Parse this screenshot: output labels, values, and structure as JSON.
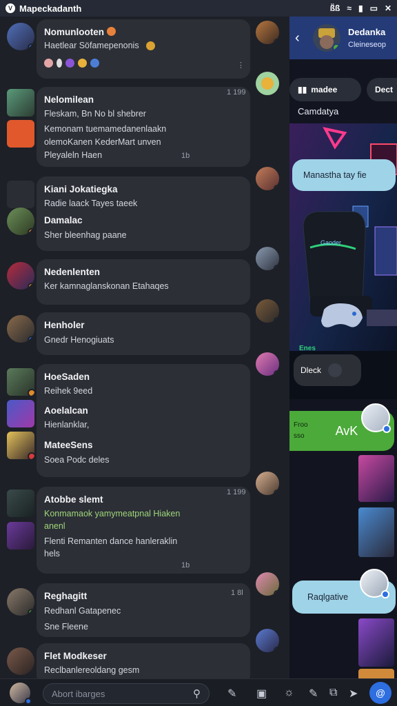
{
  "status": {
    "app_title": "Mapeckadanth",
    "right_text": "ß̈ß"
  },
  "chats": [
    {
      "title": "Nomunlooten",
      "line1": "Haetlear Söfamepenonis",
      "time": ""
    },
    {
      "title": "Nelomilean",
      "line1": "Fleskam, Bn No bl shebrer",
      "line2": "Kemonam tuemamedanenlaakn",
      "line3": "olemoKanen KederMart unven",
      "line4": "Pleyaleln Haen",
      "time": "1 199",
      "count": "1b"
    },
    {
      "title": "Kiani Jokatiegka",
      "line1": "Radie laack Tayes taeek",
      "sub_title": "Damalac",
      "sub_line": "Sher bleenhag paane"
    },
    {
      "title": "Nedenlenten",
      "line1": "Ker kamnaglanskonan Etahaqes"
    },
    {
      "title": "Henholer",
      "line1": "Gnedr Henogiuats"
    },
    {
      "title": "HoeSaden",
      "line1": "Reihek 9eed",
      "sub_title": "Aoelalcan",
      "sub_line": "Hienlanklar,",
      "sub2_title": "MateeSens",
      "sub2_line": "Soea Podc deles"
    },
    {
      "title": "Atobbe slemt",
      "line1": "Konmamaok yamymeatpnal Hiaken",
      "line2": "anenl",
      "line3": "Flenti Remanten dance hanleraklin",
      "line4": "hels",
      "time": "1 199",
      "count": "1b"
    },
    {
      "title": "Reghagitt",
      "line1": "Redhanl Gatapenec",
      "line2": "Sne Fleene",
      "time": "1 8l"
    },
    {
      "title": "Flet Modkeser",
      "line1": "Reclbanlereoldang gesm"
    }
  ],
  "panel": {
    "name": "Dedanka",
    "sub": "Cleineseop",
    "pill1": "madee",
    "pill2": "Dect",
    "title": "Camdatya",
    "chair_label": "Gaoder",
    "bubble1": "Manastha tay fie",
    "bubble2_label": "Dleck",
    "green_small": "Froo",
    "green_small2": "sso",
    "green_big": "AvK",
    "bubble3": "Raqlgative",
    "tag": "Enes"
  },
  "bottom": {
    "search_placeholder": "Abort ibarges"
  },
  "colors": {
    "accent": "#2d6ee0",
    "green": "#4caa3a",
    "bubble": "#9fd3e8",
    "card": "#2c2f36"
  }
}
